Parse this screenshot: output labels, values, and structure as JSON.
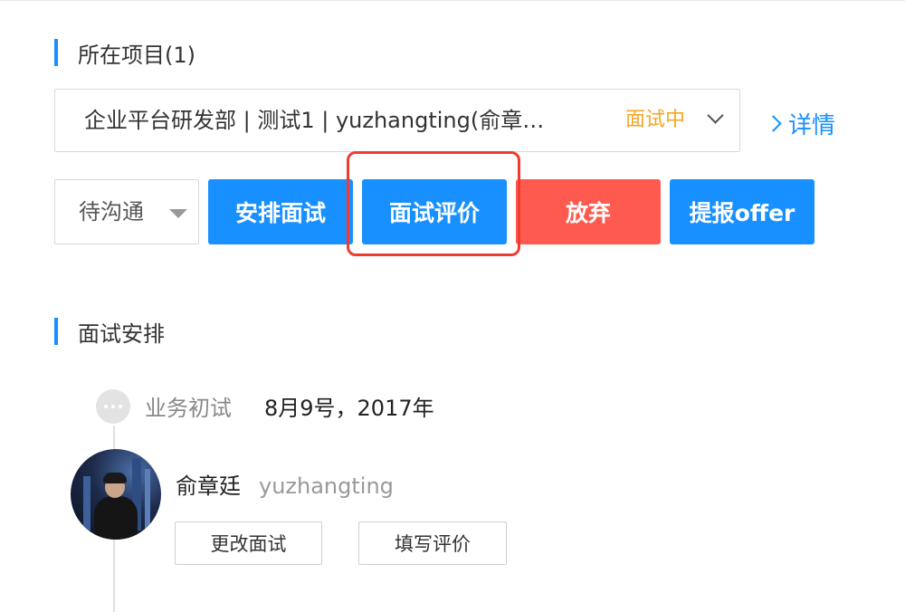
{
  "project_section": {
    "title": "所在项目(1)"
  },
  "project_select": {
    "name": "企业平台研发部 | 测试1 | yuzhangting(俞章…",
    "status": "面试中",
    "status_color": "#f5a623"
  },
  "detail_link": {
    "label": "详情"
  },
  "actions": {
    "status_dropdown": "待沟通",
    "arrange_interview": "安排面试",
    "interview_evaluation": "面试评价",
    "abandon": "放弃",
    "submit_offer": "提报offer"
  },
  "interview_section": {
    "title": "面试安排"
  },
  "interview": {
    "type": "业务初试",
    "date": "8月9号，2017年",
    "interviewer_name": "俞章廷",
    "interviewer_id": "yuzhangting",
    "change_button": "更改面试",
    "fill_button": "填写评价"
  },
  "colors": {
    "primary": "#1890ff",
    "danger": "#ff5a4f",
    "highlight": "#f23b30"
  },
  "icons": {
    "dropdown": "chevron-down-icon",
    "detail": "chevron-right-icon",
    "timeline": "more-dots-icon"
  }
}
